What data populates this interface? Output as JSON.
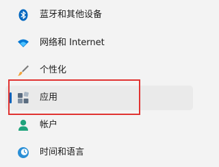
{
  "nav": {
    "items": [
      {
        "label": "蓝牙和其他设备",
        "icon": "bluetooth-icon"
      },
      {
        "label": "网络和 Internet",
        "icon": "wifi-icon"
      },
      {
        "label": "个性化",
        "icon": "brush-icon"
      },
      {
        "label": "应用",
        "icon": "apps-icon",
        "selected": true
      },
      {
        "label": "帐户",
        "icon": "account-icon"
      },
      {
        "label": "时间和语言",
        "icon": "clock-globe-icon"
      }
    ],
    "highlight_color": "#e0312f",
    "accent_color": "#005fb8"
  }
}
